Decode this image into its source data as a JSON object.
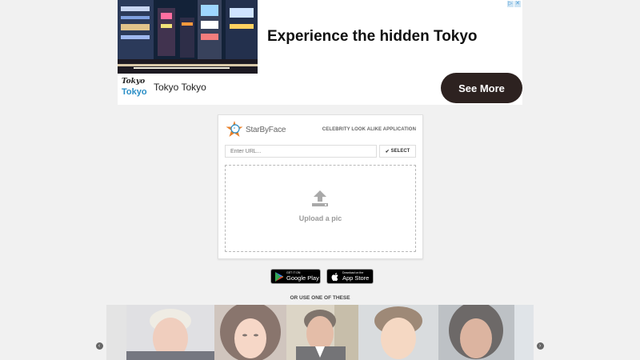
{
  "ad": {
    "headline": "Experience the hidden Tokyo",
    "logo_line1": "Tokyo",
    "logo_line2": "Tokyo",
    "brand": "Tokyo Tokyo",
    "cta": "See More",
    "badge_icons": [
      "adchoices-icon",
      "close-icon"
    ]
  },
  "app": {
    "name": "StarByFace",
    "tagline": "CELEBRITY LOOK ALIKE APPLICATION",
    "url_placeholder": "Enter URL...",
    "select_label": "SELECT",
    "upload_label": "Upload a pic"
  },
  "stores": {
    "google_small": "GET IT ON",
    "google_big": "Google Play",
    "apple_small": "Download on the",
    "apple_big": "App Store"
  },
  "carousel": {
    "label": "OR USE ONE OF THESE",
    "faces": [
      "face-1",
      "face-2",
      "face-3",
      "face-4",
      "face-5"
    ]
  },
  "colors": {
    "page_bg": "#f1f1f1",
    "cta_bg": "#2d2220",
    "logo_blue": "#2a8ec6",
    "logo_orange": "#e8802a"
  }
}
